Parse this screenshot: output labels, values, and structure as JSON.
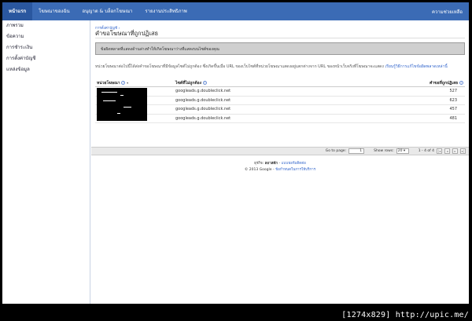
{
  "nav": {
    "tabs": [
      {
        "label": "หน้าแรก",
        "active": true
      },
      {
        "label": "โฆษณาของฉัน",
        "active": false
      },
      {
        "label": "อนุญาต & บล็อกโฆษณา",
        "active": false
      },
      {
        "label": "รายงานประสิทธิภาพ",
        "active": false
      }
    ],
    "right_label": "ความช่วยเหลือ"
  },
  "sidebar": {
    "items": [
      {
        "label": "ภาพรวม"
      },
      {
        "label": "ข้อความ"
      },
      {
        "label": "การชำระเงิน"
      },
      {
        "label": "การตั้งค่าบัญชี"
      },
      {
        "label": "แหล่งข้อมูล"
      }
    ]
  },
  "main": {
    "breadcrumb": "การตั้งค่าบัญชี ›",
    "title": "คำขอโฆษณาที่ถูกปฏิเสธ",
    "notice": "ข้อผิดพลาดที่แสดงด้านล่างทำให้เกิดโฆษณาว่างที่แสดงบนไซต์ของคุณ",
    "description": "หน่วยโฆษณาต่อไปนี้ได้ส่งคำขอโฆษณาที่มีข้อมูลไซต์ไม่ถูกต้อง ซึ่งเกิดขึ้นเมื่อ URL ของเว็บไซต์ที่หน่วยโฆษณาแสดงอยู่แตกต่างจาก URL ของหน้าเว็บจริงที่โฆษณาจะแสดง",
    "help_link": "เรียนรู้วิธีการแก้ไขข้อผิดพลาดเหล่านี้"
  },
  "table": {
    "headers": {
      "unit": "หน่วยโฆษณา",
      "site": "ไซต์ที่ไม่ถูกต้อง",
      "count": "คำขอที่ถูกปฏิเสธ"
    },
    "rows": [
      {
        "site": "googleads.g.doubleclick.net",
        "count": "527"
      },
      {
        "site": "googleads.g.doubleclick.net",
        "count": "623"
      },
      {
        "site": "googleads.g.doubleclick.net",
        "count": "457"
      },
      {
        "site": "googleads.g.doubleclick.net",
        "count": "481"
      }
    ]
  },
  "pager": {
    "goto_label": "Go to page:",
    "goto_value": "1",
    "show_rows_label": "Show rows:",
    "show_rows_value": "20 ▾",
    "range": "1 - 4 of 4",
    "first": "|◂",
    "prev": "◂",
    "next": "▸",
    "last": "▸|"
  },
  "footer": {
    "line1_prefix": "ธุรกิจ:",
    "line1_bold": "ลอาสตัก",
    "line1_sep": "-",
    "line1_link": "แบบฟอร์มติดต่อ",
    "copyright": "© 2013 Google -",
    "terms_link": "ข้อกำหนดในการให้บริการ"
  },
  "watermark": "[1274x829] http://upic.me/",
  "colors": {
    "nav_bg": "#3b6bb5",
    "nav_active": "#2a579f",
    "link": "#3366cc",
    "notice_bg": "#cfcfcf"
  }
}
